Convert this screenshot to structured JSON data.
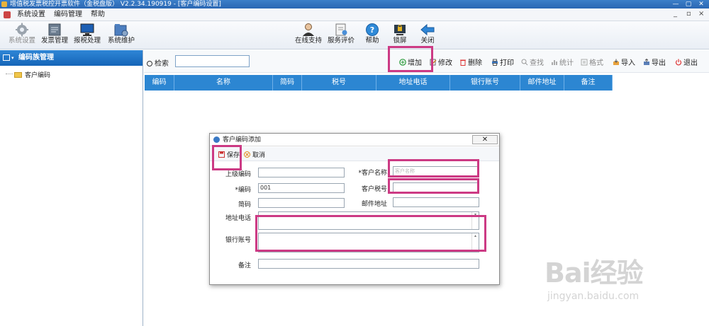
{
  "window": {
    "title": "增值税发票税控开票软件（金税盘版） V2.2.34.190919 - [客户编码设置]",
    "btn_min": "—",
    "btn_max": "▢",
    "btn_close": "✕"
  },
  "menu": {
    "items": [
      "系统设置",
      "编码管理",
      "帮助"
    ],
    "ctrl_min": "_",
    "ctrl_restore": "▫",
    "ctrl_close": "×"
  },
  "toolbar": {
    "left": [
      {
        "label": "系统设置",
        "icon": "gear-icon"
      },
      {
        "label": "发票管理",
        "icon": "invoice-icon"
      },
      {
        "label": "报税处理",
        "icon": "monitor-icon"
      },
      {
        "label": "系统维护",
        "icon": "folder-gear-icon"
      }
    ],
    "right": [
      {
        "label": "在线支持",
        "icon": "support-person-icon"
      },
      {
        "label": "服务评价",
        "icon": "document-rating-icon"
      },
      {
        "label": "帮助",
        "icon": "help-icon"
      },
      {
        "label": "锁屏",
        "icon": "lock-screen-icon"
      },
      {
        "label": "关闭",
        "icon": "back-arrow-icon"
      }
    ]
  },
  "left_panel": {
    "header": "编码族管理",
    "tree_item": "客户编码"
  },
  "search": {
    "label": "检索",
    "value": ""
  },
  "actions": [
    {
      "label": "增加",
      "icon": "add-circle-icon",
      "enabled": true
    },
    {
      "label": "修改",
      "icon": "edit-icon",
      "enabled": true
    },
    {
      "label": "删除",
      "icon": "trash-icon",
      "enabled": true
    },
    {
      "label": "打印",
      "icon": "printer-icon",
      "enabled": true
    },
    {
      "label": "查找",
      "icon": "search-icon",
      "enabled": false
    },
    {
      "label": "统计",
      "icon": "chart-icon",
      "enabled": false
    },
    {
      "label": "格式",
      "icon": "format-icon",
      "enabled": false
    },
    {
      "label": "导入",
      "icon": "import-icon",
      "enabled": true
    },
    {
      "label": "导出",
      "icon": "export-icon",
      "enabled": true
    },
    {
      "label": "退出",
      "icon": "power-icon",
      "enabled": true
    }
  ],
  "grid": {
    "columns": [
      "编码",
      "名称",
      "简码",
      "税号",
      "地址电话",
      "银行账号",
      "邮件地址",
      "备注"
    ]
  },
  "dialog": {
    "title": "客户编码添加",
    "close_label": "✕",
    "save": "保存",
    "cancel": "取消",
    "fields": {
      "parent_code": {
        "label": "上级编码",
        "value": ""
      },
      "code": {
        "label": "*编码",
        "value": "001"
      },
      "short_code": {
        "label": "简码",
        "value": ""
      },
      "customer_name": {
        "label": "*客户名称",
        "placeholder": "客户名称"
      },
      "tax_id": {
        "label": "客户税号",
        "value": ""
      },
      "email": {
        "label": "邮件地址",
        "value": ""
      },
      "address_phone": {
        "label": "地址电话",
        "value": ""
      },
      "bank_account": {
        "label": "银行账号",
        "value": ""
      },
      "note": {
        "label": "备注",
        "value": ""
      }
    }
  },
  "colors": {
    "accent": "#2c86d2",
    "highlight": "#cc3a84",
    "title_bar": "#2a67b3"
  },
  "watermark": {
    "brand": "Bai经验",
    "url": "jingyan.baidu.com"
  }
}
